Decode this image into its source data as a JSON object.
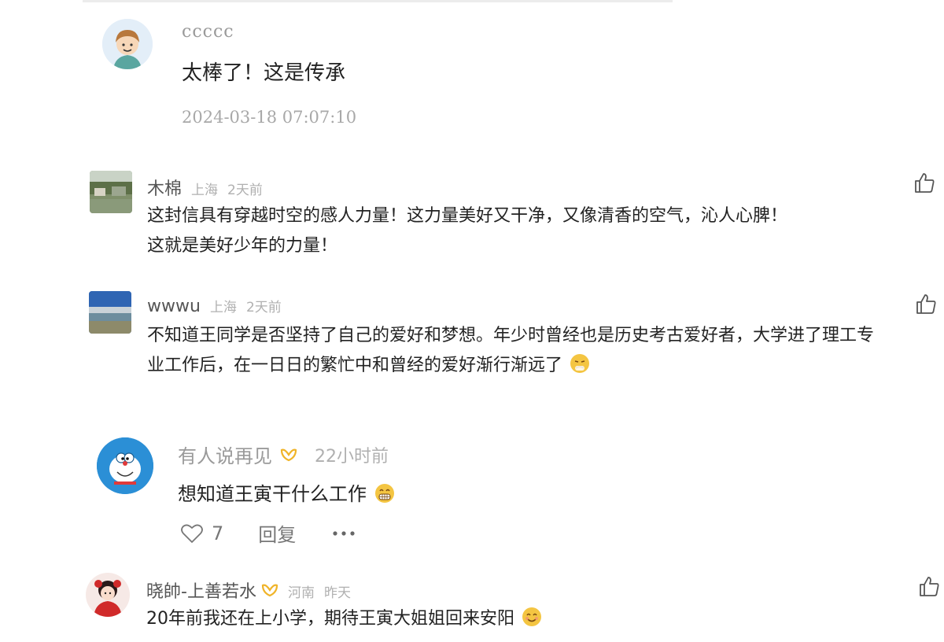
{
  "comments": [
    {
      "username": "ccccc",
      "text": "太棒了！这是传承",
      "timestamp": "2024-03-18 07:07:10",
      "avatar": "cartoon-boy-avatar"
    },
    {
      "username": "木棉",
      "location": "上海",
      "time_ago": "2天前",
      "lines": [
        "这封信具有穿越时空的感人力量！这力量美好又干净，又像清香的空气，沁人心脾！",
        "这就是美好少年的力量！"
      ],
      "avatar": "landscape-photo-avatar"
    },
    {
      "username": "wwwu",
      "location": "上海",
      "time_ago": "2天前",
      "lines": [
        "不知道王同学是否坚持了自己的爱好和梦想。年少时曾经也是历史考古爱好者，大学进了理工专",
        "业工作后，在一日日的繁忙中和曾经的爱好渐行渐远了"
      ],
      "emoji": "sad-face-emoji",
      "avatar": "sea-photo-avatar"
    },
    {
      "username": "有人说再见",
      "badge": "vip-badge",
      "time_ago": "22小时前",
      "text": "想知道王寅干什么工作",
      "emoji": "grin-emoji",
      "likes": "7",
      "reply_label": "回复",
      "avatar": "doraemon-avatar"
    },
    {
      "username": "晓帥-上善若水",
      "badge": "vip-badge",
      "location": "河南",
      "time_ago": "昨天",
      "text": "20年前我还在上小学，期待王寅大姐姐回来安阳",
      "emoji": "smile-emoji",
      "avatar": "girl-cartoon-avatar"
    }
  ],
  "colors": {
    "text_primary": "#222222",
    "text_meta": "#b0b0b0",
    "vip_gold": "#f0b429",
    "avatar_blue": "#2b8fd6"
  }
}
